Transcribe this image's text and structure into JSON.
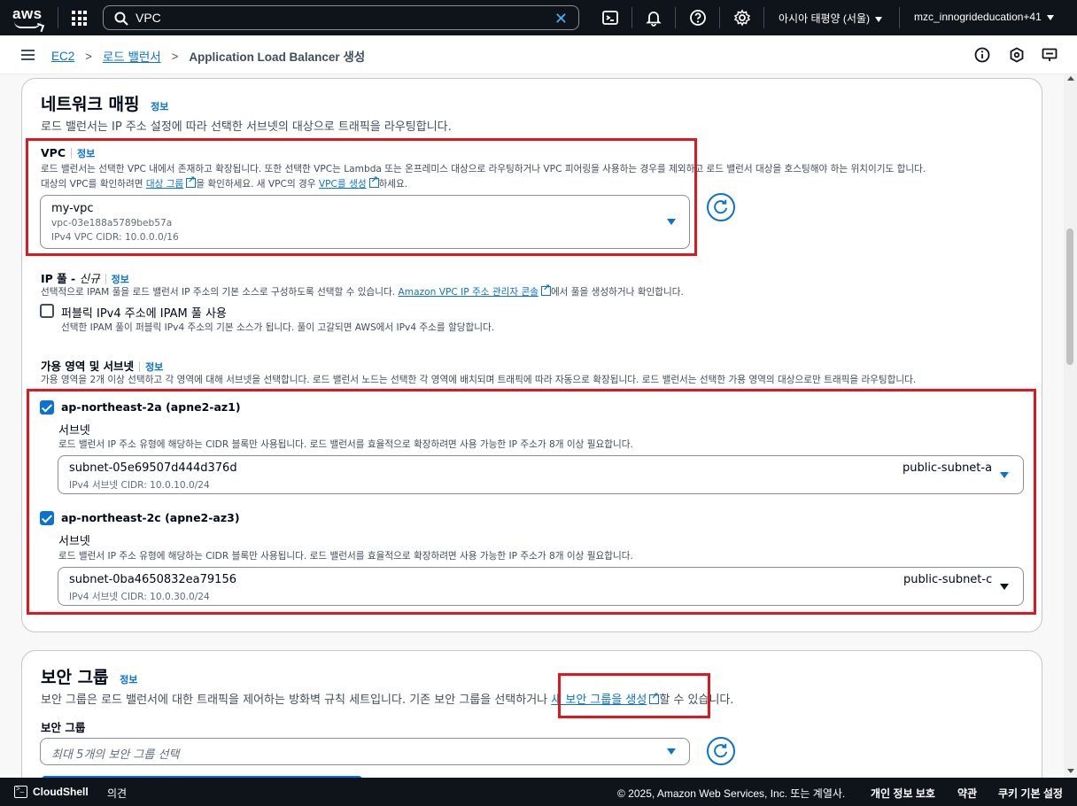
{
  "topnav": {
    "logo_text": "aws",
    "search_value": "VPC",
    "region": "아시아 태평양 (서울)",
    "account": "mzc_innogrideducation+41"
  },
  "breadcrumb": {
    "items": [
      "EC2",
      "로드 밸런서"
    ],
    "current": "Application Load Balancer 생성"
  },
  "network": {
    "title": "네트워크 매핑",
    "info": "정보",
    "description": "로드 밸런서는 IP 주소 설정에 따라 선택한 서브넷의 대상으로 트래픽을 라우팅합니다.",
    "vpc": {
      "label": "VPC",
      "info": "정보",
      "desc1": "로드 밸런서는 선택한 VPC 내에서 존재하고 확장됩니다. 또한 선택한 VPC는 Lambda 또는 온프레미스 대상으로 라우팅하거나 VPC 피어링을 사용하는 경우를 제외하고 로드 밸런서 대상을 호스팅해야 하는 위치이기도 합니다.",
      "desc2_a": "대상의 VPC를 확인하려면 ",
      "desc2_link1": "대상 그룹",
      "desc2_b": "을 확인하세요. 새 VPC의 경우 ",
      "desc2_link2": "VPC를 생성",
      "desc2_c": "하세요.",
      "selected_name": "my-vpc",
      "selected_id": "vpc-03e188a5789beb57a",
      "selected_cidr": "IPv4 VPC CIDR: 10.0.0.0/16"
    },
    "ippool": {
      "label": "IP 풀 - ",
      "label_new": "신규",
      "info": "정보",
      "desc_a": "선택적으로 IPAM 풀을 로드 밸런서 IP 주소의 기본 소스로 구성하도록 선택할 수 있습니다. ",
      "desc_link": "Amazon VPC IP 주소 관리자 콘솔",
      "desc_b": "에서 풀을 생성하거나 확인합니다.",
      "checkbox_label": "퍼블릭 IPv4 주소에 IPAM 풀 사용",
      "checkbox_desc": "선택한 IPAM 풀이 퍼블릭 IPv4 주소의 기본 소스가 됩니다. 풀이 고갈되면 AWS에서 IPv4 주소를 할당합니다."
    },
    "az": {
      "label": "가용 영역 및 서브넷",
      "info": "정보",
      "desc": "가용 영역을 2개 이상 선택하고 각 영역에 대해 서브넷을 선택합니다. 로드 밸런서 노드는 선택한 각 영역에 배치되며 트래픽에 따라 자동으로 확장됩니다. 로드 밸런서는 선택한 가용 영역의 대상으로만 트래픽을 라우팅합니다.",
      "zones": [
        {
          "name": "ap-northeast-2a (apne2-az1)",
          "subnet_label": "서브넷",
          "subnet_desc": "로드 밸런서 IP 주소 유형에 해당하는 CIDR 블록만 사용됩니다. 로드 밸런서를 효율적으로 확장하려면 사용 가능한 IP 주소가 8개 이상 필요합니다.",
          "subnet_id": "subnet-05e69507d444d376d",
          "subnet_cidr": "IPv4 서브넷 CIDR: 10.0.10.0/24",
          "subnet_name": "public-subnet-a"
        },
        {
          "name": "ap-northeast-2c (apne2-az3)",
          "subnet_label": "서브넷",
          "subnet_desc": "로드 밸런서 IP 주소 유형에 해당하는 CIDR 블록만 사용됩니다. 로드 밸런서를 효율적으로 확장하려면 사용 가능한 IP 주소가 8개 이상 필요합니다.",
          "subnet_id": "subnet-0ba4650832ea79156",
          "subnet_cidr": "IPv4 서브넷 CIDR: 10.0.30.0/24",
          "subnet_name": "public-subnet-c"
        }
      ]
    }
  },
  "security": {
    "title": "보안 그룹",
    "info": "정보",
    "desc_a": "보안 그룹은 로드 밸런서에 대한 트래픽을 제어하는 방화벽 규칙 세트입니다. 기존 보안 그룹을 선택하거나 ",
    "desc_link": "새 보안 그룹을 생성",
    "desc_b": "할 수 있습니다.",
    "label": "보안 그룹",
    "placeholder": "최대 5개의 보안 그룹 선택"
  },
  "footer": {
    "cloudshell": "CloudShell",
    "feedback": "의견",
    "copyright": "© 2025, Amazon Web Services, Inc. 또는 계열사.",
    "privacy": "개인 정보 보호",
    "terms": "약관",
    "cookies": "쿠키 기본 설정"
  },
  "colors": {
    "link": "#0972d3",
    "nav_bg": "#0f141a",
    "highlight": "#e0171f"
  }
}
